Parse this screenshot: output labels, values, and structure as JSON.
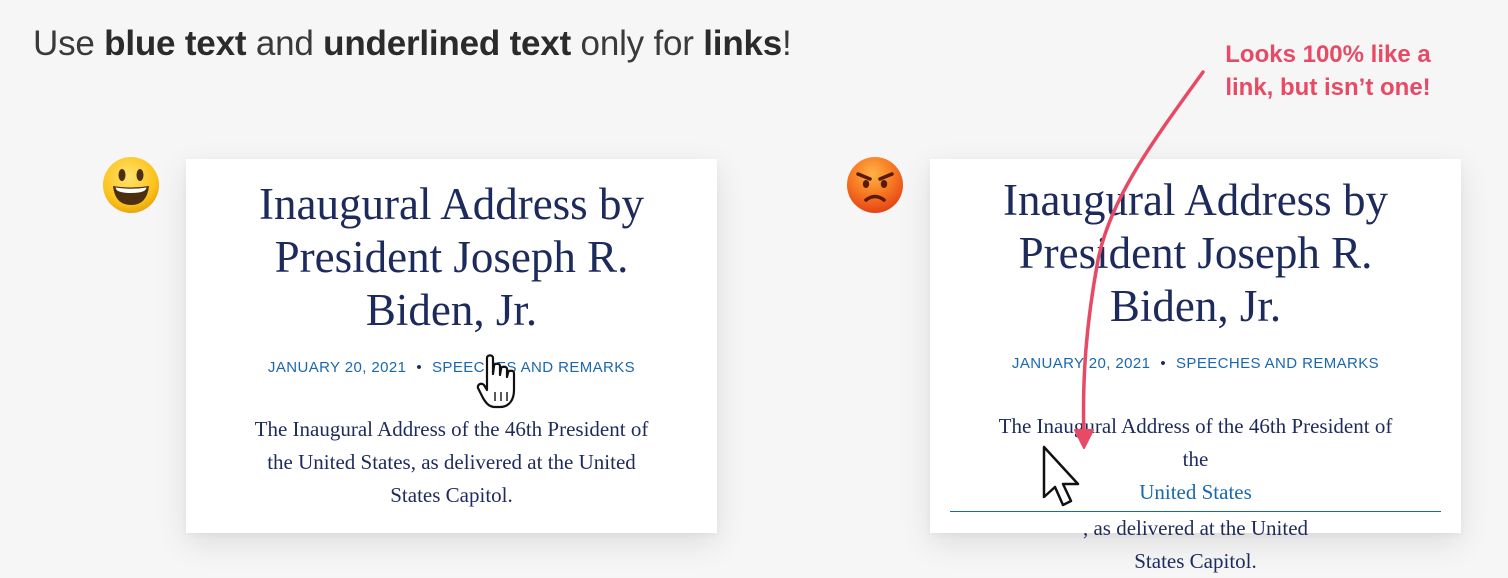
{
  "headline": {
    "part1": "Use ",
    "bold1": "blue text",
    "part2": " and ",
    "bold2": "underlined text",
    "part3": " only for ",
    "bold3": "links",
    "part4": "!"
  },
  "annotation": {
    "line1": "Looks 100% like a",
    "line2": "link, but isn’t one!"
  },
  "card_good": {
    "title_lines": [
      "Inaugural Address by",
      "President Joseph R.",
      "Biden, Jr."
    ],
    "date": "JANUARY 20, 2021",
    "separator": "•",
    "category": "SPEECHES AND REMARKS",
    "body_line1": "The Inaugural Address of the 46th President of",
    "body_line2": "the United States, as delivered at the United",
    "body_line3": "States Capitol."
  },
  "card_bad": {
    "title_lines": [
      "Inaugural Address by",
      "President Joseph R.",
      "Biden, Jr."
    ],
    "date": "JANUARY 20, 2021",
    "separator": "•",
    "category": "SPEECHES AND REMARKS",
    "body_line1": "The Inaugural Address of the 46th President of",
    "body_line2_pre": "the ",
    "body_line2_link": "United States",
    "body_line2_post": " , as delivered at the United",
    "body_line3": "States Capitol."
  },
  "colors": {
    "link_blue": "#1a67b0",
    "title_navy": "#1d2a5c",
    "annotation_red": "#e74a64"
  },
  "icons": {
    "good_example": "smiling-face-emoji-icon",
    "bad_example": "angry-face-emoji-icon",
    "good_cursor": "hand-pointer-cursor-icon",
    "bad_cursor": "arrow-cursor-icon",
    "annotation_arrow": "curved-arrow-icon"
  }
}
